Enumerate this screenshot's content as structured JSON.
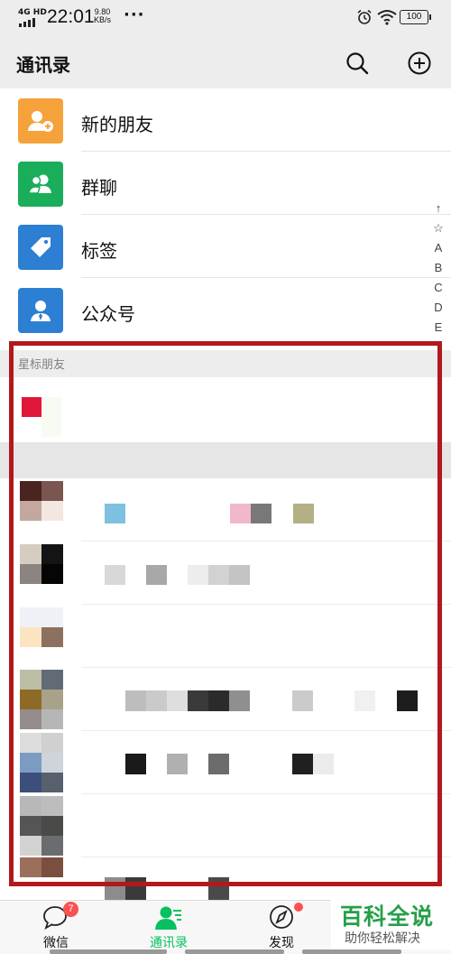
{
  "status_bar": {
    "network": "4G HD",
    "time": "22:01",
    "speed_value": "9.80",
    "speed_unit": "KB/s",
    "more": "···",
    "battery": "100",
    "icons": [
      "signal-icon",
      "alarm-icon",
      "wifi-icon",
      "battery-icon"
    ]
  },
  "header": {
    "title": "通讯录",
    "icons": [
      "search-icon",
      "add-icon"
    ]
  },
  "fixed_items": [
    {
      "label": "新的朋友",
      "icon": "add-friend-icon",
      "color": "#f6a23a"
    },
    {
      "label": "群聊",
      "icon": "group-chat-icon",
      "color": "#1aad5a"
    },
    {
      "label": "标签",
      "icon": "tag-icon",
      "color": "#2d7fd3"
    },
    {
      "label": "公众号",
      "icon": "official-account-icon",
      "color": "#2d7fd3"
    }
  ],
  "section": {
    "starred_title": "星标朋友"
  },
  "index_bar": [
    "↑",
    "☆",
    "A",
    "B",
    "C",
    "D",
    "E"
  ],
  "bottom_nav": {
    "tabs": [
      {
        "label": "微信",
        "icon": "chat-icon",
        "badge": "7",
        "active": false
      },
      {
        "label": "通讯录",
        "icon": "contacts-icon",
        "active": true
      },
      {
        "label": "发现",
        "icon": "compass-icon",
        "active": false
      }
    ],
    "active_color": "#07c160"
  },
  "watermark": {
    "title": "百科全说",
    "subtitle": "助你轻松解决"
  },
  "annotation_color": "#b1191c"
}
